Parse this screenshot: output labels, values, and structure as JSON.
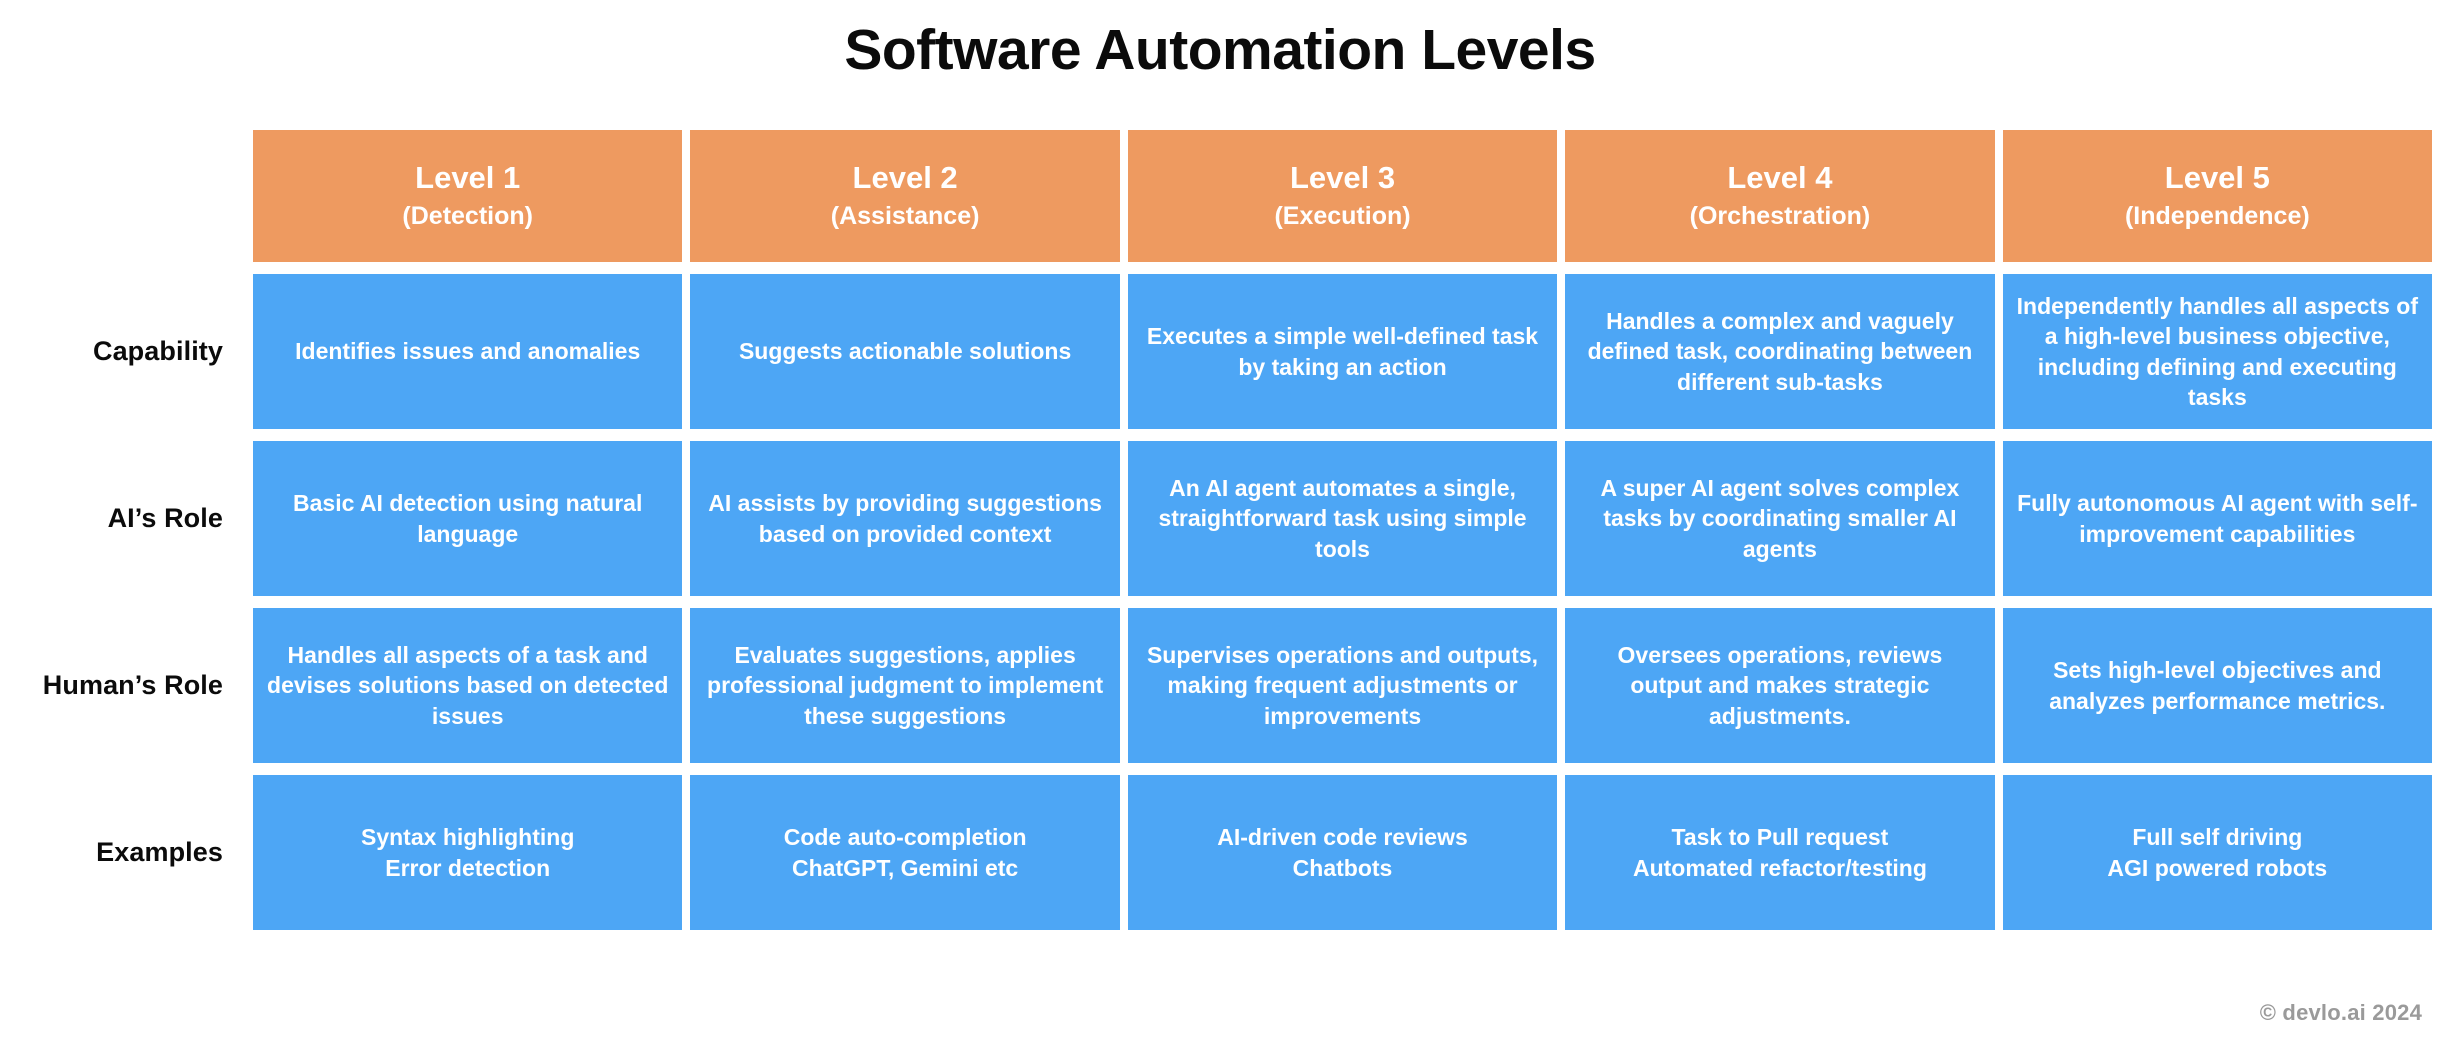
{
  "page": {
    "title": "Software Automation Levels",
    "footer": "© devlo.ai 2024"
  },
  "colors": {
    "header_cell": "#ee9a60",
    "body_cell": "#4da6f5",
    "title_text": "#0b0b0b",
    "cell_text": "#ffffff",
    "footer_text": "#9a9a9a",
    "background": "#ffffff"
  },
  "chart_data": {
    "type": "table",
    "title": "Software Automation Levels",
    "column_headers": [
      {
        "level": "Level 1",
        "name": "(Detection)"
      },
      {
        "level": "Level 2",
        "name": "(Assistance)"
      },
      {
        "level": "Level 3",
        "name": "(Execution)"
      },
      {
        "level": "Level 4",
        "name": "(Orchestration)"
      },
      {
        "level": "Level 5",
        "name": "(Independence)"
      }
    ],
    "row_headers": [
      "Capability",
      "AI’s Role",
      "Human’s Role",
      "Examples"
    ],
    "rows": [
      {
        "label": "Capability",
        "cells": [
          "Identifies issues and anomalies",
          "Suggests actionable solutions",
          "Executes a simple well-defined task by taking an action",
          "Handles a complex and vaguely defined task, coordinating between different sub-tasks",
          "Independently handles all aspects of a high-level business objective, including defining and executing tasks"
        ]
      },
      {
        "label": "AI’s Role",
        "cells": [
          "Basic AI detection using natural language",
          "AI assists by providing suggestions based on provided context",
          "An AI agent automates a single, straightforward task using simple tools",
          "A super AI agent solves complex tasks by coordinating smaller AI agents",
          "Fully autonomous AI agent with self-improvement capabilities"
        ]
      },
      {
        "label": "Human’s Role",
        "cells": [
          "Handles all aspects of a task and devises solutions based on detected issues",
          "Evaluates suggestions, applies professional judgment to implement these suggestions",
          "Supervises operations and outputs, making frequent adjustments or improvements",
          "Oversees operations, reviews output and makes strategic adjustments.",
          "Sets high-level objectives and analyzes performance metrics."
        ]
      },
      {
        "label": "Examples",
        "cells": [
          "Syntax highlighting\nError detection",
          "Code auto-completion\nChatGPT, Gemini etc",
          "AI-driven code reviews\nChatbots",
          "Task to Pull request\nAutomated refactor/testing",
          "Full self driving\nAGI powered robots"
        ]
      }
    ]
  }
}
